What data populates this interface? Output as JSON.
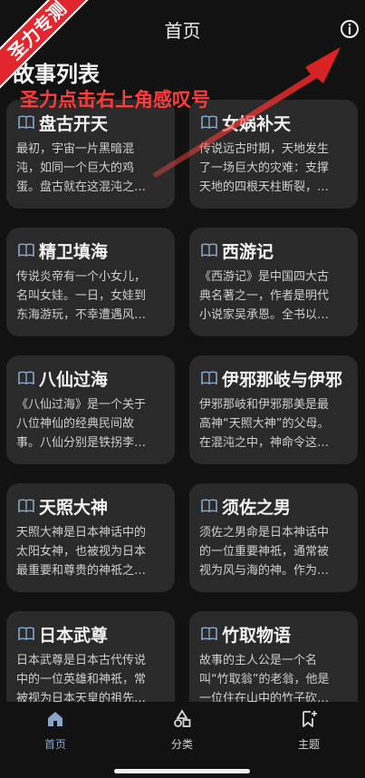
{
  "header": {
    "title": "首页"
  },
  "watermark": {
    "ribbon": "圣力专测",
    "annotation": "圣力点击右上角感叹号"
  },
  "section": {
    "title": "故事列表"
  },
  "stories": [
    {
      "title": "盘古开天",
      "desc": [
        "最初，宇宙一片黑暗混",
        "沌，如同一个巨大的鸡",
        "蛋。盘古就在这混沌之…"
      ]
    },
    {
      "title": "女娲补天",
      "desc": [
        "传说远古时期，天地发生",
        "了一场巨大的灾难：支撑",
        "天地的四根天柱断裂，…"
      ]
    },
    {
      "title": "精卫填海",
      "desc": [
        "传说炎帝有一个小女儿，",
        "名叫女娃。一日，女娃到",
        "东海游玩，不幸遭遇风…"
      ]
    },
    {
      "title": "西游记",
      "desc": [
        "《西游记》是中国四大古",
        "典名著之一，作者是明代",
        "小说家吴承恩。全书以…"
      ]
    },
    {
      "title": "八仙过海",
      "desc": [
        "《八仙过海》是一个关于",
        "八位神仙的经典民间故",
        "事。八仙分别是铁拐李…"
      ]
    },
    {
      "title": "伊邪那岐与伊邪",
      "desc": [
        "伊邪那岐和伊邪那美是最",
        "高神“天照大神”的父母。",
        "在混沌之中，神命令这…"
      ]
    },
    {
      "title": "天照大神",
      "desc": [
        "天照大神是日本神话中的",
        "太阳女神，也被视为日本",
        "最重要和尊贵的神祇之…"
      ]
    },
    {
      "title": "须佐之男",
      "desc": [
        "须佐之男命是日本神话中",
        "的一位重要神祇，通常被",
        "视为风与海的神。作为…"
      ]
    },
    {
      "title": "日本武尊",
      "desc": [
        "日本武尊是日本古代传说",
        "中的一位英雄和神祇，常",
        "被视为日本天皇的祖先…"
      ]
    },
    {
      "title": "竹取物语",
      "desc": [
        "故事的主人公是一个名",
        "叫“竹取翁”的老翁，他是",
        "一位住在山中的竹子砍…"
      ]
    }
  ],
  "tabs": [
    {
      "label": "首页",
      "icon": "home-icon",
      "active": true
    },
    {
      "label": "分类",
      "icon": "shapes-icon",
      "active": false
    },
    {
      "label": "主题",
      "icon": "bookmark-plus-icon",
      "active": false
    }
  ],
  "colors": {
    "background": "#121212",
    "card": "#2a2a2a",
    "accent": "#8aa6c8",
    "annotation": "#ff3b3b"
  }
}
